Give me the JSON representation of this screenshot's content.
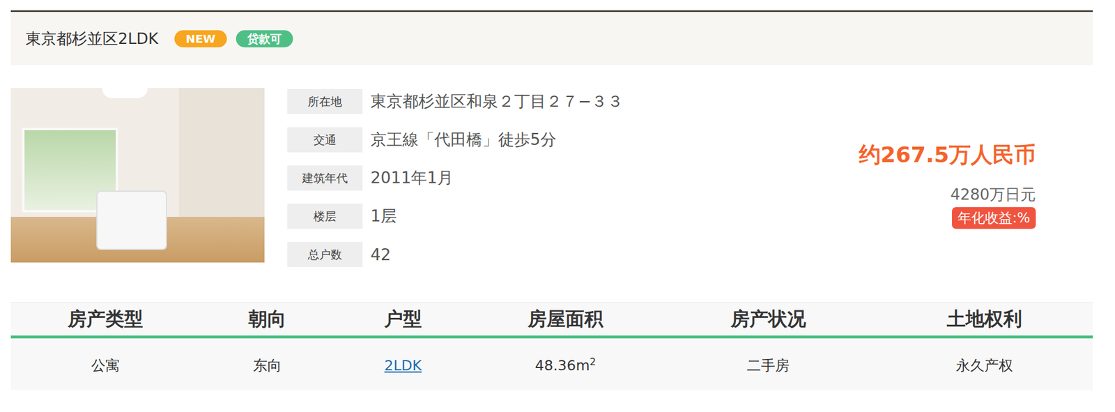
{
  "listing": {
    "title": "東京都杉並区2LDK",
    "badges": [
      {
        "label": "NEW",
        "color": "#f8a51f"
      },
      {
        "label": "贷款可",
        "color": "#4fbf86"
      }
    ],
    "details": [
      {
        "label": "所在地",
        "value": "東京都杉並区和泉２丁目２７−３３"
      },
      {
        "label": "交通",
        "value": "京王線「代田橋」徒歩5分"
      },
      {
        "label": "建筑年代",
        "value": "2011年1月"
      },
      {
        "label": "楼层",
        "value": "1层"
      },
      {
        "label": "总户数",
        "value": "42"
      }
    ],
    "price": {
      "cny": "约267.5万人民币",
      "jpy": "4280万日元",
      "yield": "年化收益:%"
    }
  },
  "table": {
    "columns": [
      "房产类型",
      "朝向",
      "户型",
      "房屋面积",
      "房产状况",
      "土地权利"
    ],
    "rows": [
      {
        "cells": [
          {
            "text": "公寓",
            "kind": "plain"
          },
          {
            "text": "东向",
            "kind": "plain"
          },
          {
            "text": "2LDK",
            "kind": "link"
          },
          {
            "text": "48.36m",
            "kind": "area",
            "sup": "2"
          },
          {
            "text": "二手房",
            "kind": "plain"
          },
          {
            "text": "永久产权",
            "kind": "plain"
          }
        ]
      }
    ]
  }
}
